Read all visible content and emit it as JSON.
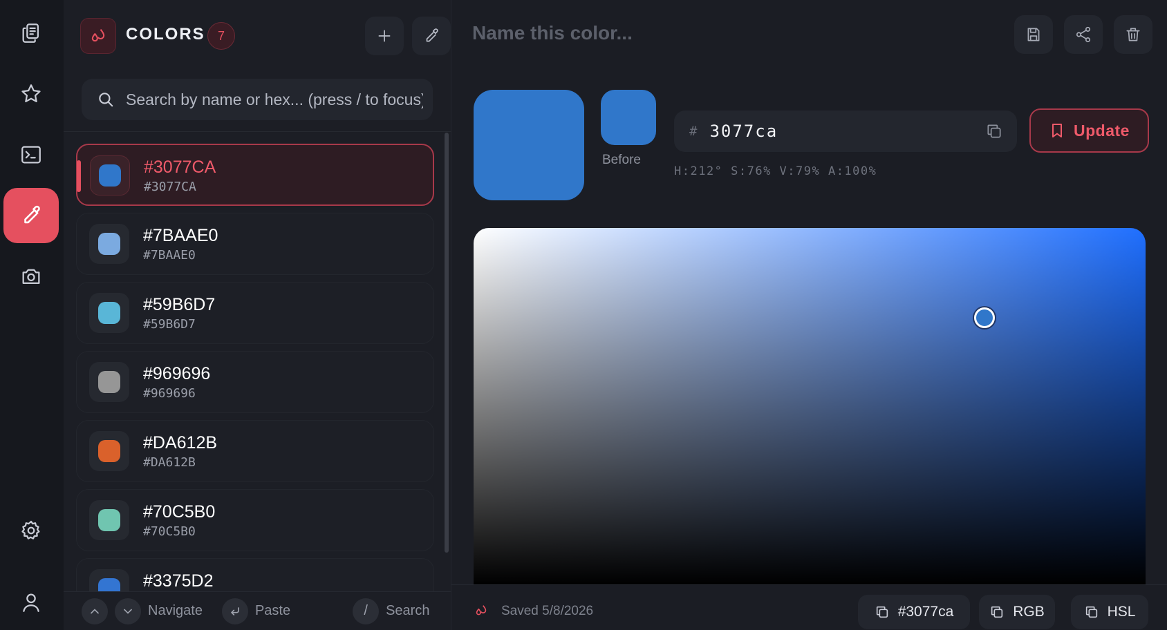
{
  "rail": {
    "items": [
      {
        "name": "clipboard-icon"
      },
      {
        "name": "star-icon"
      },
      {
        "name": "terminal-icon"
      },
      {
        "name": "eyedropper-icon",
        "active": true
      },
      {
        "name": "camera-icon"
      },
      {
        "name": "gear-icon"
      },
      {
        "name": "user-icon"
      }
    ]
  },
  "panel": {
    "title": "COLORS",
    "count": "7",
    "search": {
      "placeholder": "Search by name or hex... (press / to focus)",
      "value": ""
    },
    "colors": [
      {
        "name": "#3077CA",
        "hex": "#3077CA",
        "swatch": "#3077CA",
        "selected": true
      },
      {
        "name": "#7BAAE0",
        "hex": "#7BAAE0",
        "swatch": "#7BAAE0"
      },
      {
        "name": "#59B6D7",
        "hex": "#59B6D7",
        "swatch": "#59B6D7"
      },
      {
        "name": "#969696",
        "hex": "#969696",
        "swatch": "#969696"
      },
      {
        "name": "#DA612B",
        "hex": "#DA612B",
        "swatch": "#DA612B"
      },
      {
        "name": "#70C5B0",
        "hex": "#70C5B0",
        "swatch": "#70C5B0"
      },
      {
        "name": "#3375D2",
        "hex": "#3375D2",
        "swatch": "#3375D2"
      }
    ],
    "footer": {
      "navigate": "Navigate",
      "paste": "Paste",
      "search": "Search",
      "search_key": "/"
    }
  },
  "main": {
    "name_placeholder": "Name this color...",
    "name_value": "",
    "current_color": "#3077CA",
    "before_color": "#3077CA",
    "before_label": "Before",
    "hex_hash": "#",
    "hex_value": "3077ca",
    "hsva_text": "H:212° S:76% V:79% A:100%",
    "hue": 212,
    "saturation": 0.76,
    "value": 0.79,
    "update_label": "Update",
    "saved_text": "Saved 5/8/2026",
    "copy_buttons": {
      "hex": "#3077ca",
      "rgb": "RGB",
      "hsl": "HSL"
    }
  },
  "colors": {
    "accent": "#E5505F",
    "background": "#1B1D24",
    "panel": "#1C1E25",
    "rail": "#16181E"
  }
}
